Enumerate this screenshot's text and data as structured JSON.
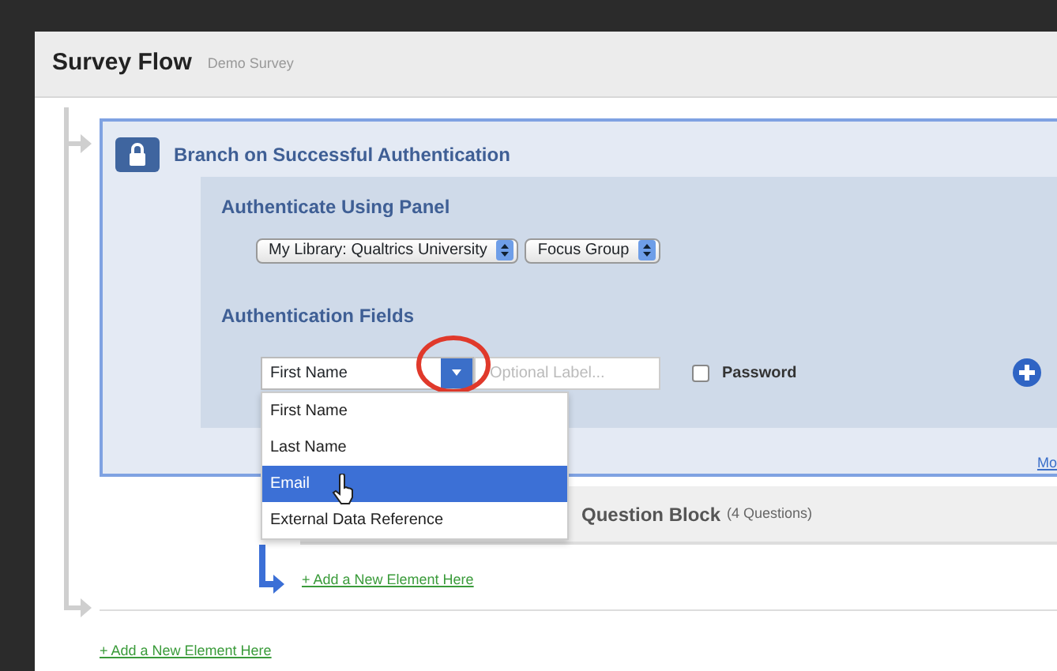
{
  "window": {
    "title": "Survey Flow",
    "subtitle": "Demo Survey"
  },
  "branch": {
    "title": "Branch on Successful Authentication",
    "panel_heading": "Authenticate Using Panel",
    "panel_selects": [
      {
        "value": "My Library: Qualtrics University"
      },
      {
        "value": "Focus Group"
      }
    ],
    "fields_heading": "Authentication Fields",
    "field": {
      "value": "First Name",
      "placeholder": "Optional Label...",
      "password": {
        "label": "Password",
        "checked": false
      }
    },
    "dropdown": {
      "expanded": true,
      "options": [
        {
          "label": "First Name",
          "selected": false
        },
        {
          "label": "Last Name",
          "selected": false
        },
        {
          "label": "Email",
          "selected": true
        },
        {
          "label": "External Data Reference",
          "selected": false
        }
      ]
    },
    "more_link": "Mo"
  },
  "block": {
    "title": "Question Block",
    "count": "(4 Questions)"
  },
  "add_links": [
    "+ Add a New Element Here",
    "+ Add a New Element Here"
  ]
}
